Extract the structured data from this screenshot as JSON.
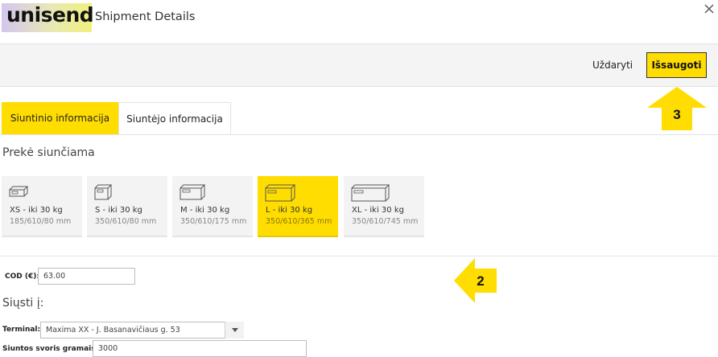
{
  "header": {
    "logo_text": "unisend",
    "title": "Shipment Details",
    "close_icon": "close-icon"
  },
  "toolbar": {
    "close_label": "Uždaryti",
    "save_label": "Išsaugoti"
  },
  "tabs": [
    {
      "label": "Siuntinio informacija",
      "active": true
    },
    {
      "label": "Siuntėjo informacija",
      "active": false
    }
  ],
  "parcel_section": {
    "title": "Prekė siunčiama",
    "sizes": [
      {
        "label": "XS - iki 30 kg",
        "dims": "185/610/80 mm",
        "selected": false
      },
      {
        "label": "S - iki 30 kg",
        "dims": "350/610/80 mm",
        "selected": false
      },
      {
        "label": "M - iki 30 kg",
        "dims": "350/610/175 mm",
        "selected": false
      },
      {
        "label": "L - iki 30 kg",
        "dims": "350/610/365 mm",
        "selected": true
      },
      {
        "label": "XL - iki 30 kg",
        "dims": "350/610/745 mm",
        "selected": false
      }
    ]
  },
  "cod": {
    "label": "COD (€):",
    "value": "63.00"
  },
  "send_section": {
    "title": "Siųsti į:",
    "terminal_label": "Terminal:",
    "terminal_value": "Maxima XX - J. Basanavičiaus g. 53",
    "weight_label": "Siuntos svoris gramais:",
    "weight_value": "3000"
  },
  "annotations": {
    "arrow_2": "2",
    "arrow_3": "3"
  },
  "colors": {
    "accent": "#ffdd00",
    "toolbar_bg": "#f4f4f4",
    "card_bg": "#f3f3f3"
  }
}
